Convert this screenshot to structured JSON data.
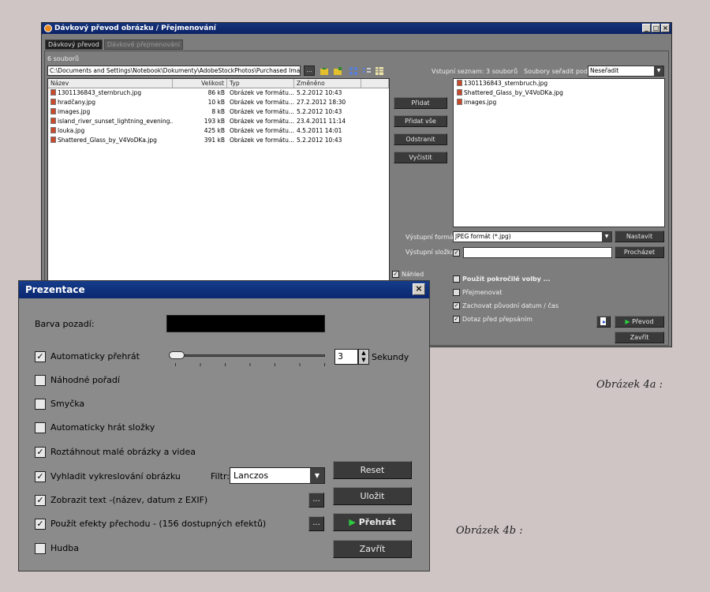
{
  "main_window": {
    "title": "Dávkový převod obrázku / Přejmenování",
    "controls": [
      "_",
      "□",
      "×"
    ],
    "tabs": [
      "Dávkový převod",
      "Dávkové přejmenování"
    ],
    "file_count": "6 souborů",
    "path": "C:\\Documents and Settings\\Notebook\\Dokumenty\\AdobeStockPhotos\\Purchased Images\\Pra",
    "path_button": "...",
    "columns": [
      "Název",
      "Velikost",
      "Typ",
      "Změněno"
    ],
    "files": [
      {
        "name": "1301136843_sternbruch.jpg",
        "size": "86 kB",
        "type": "Obrázek ve formátu...",
        "modified": "5.2.2012 10:43"
      },
      {
        "name": "hradčany.jpg",
        "size": "10 kB",
        "type": "Obrázek ve formátu...",
        "modified": "27.2.2012 18:30"
      },
      {
        "name": "images.jpg",
        "size": "8 kB",
        "type": "Obrázek ve formátu...",
        "modified": "5.2.2012 10:43"
      },
      {
        "name": "island_river_sunset_lightning_evening...",
        "size": "193 kB",
        "type": "Obrázek ve formátu...",
        "modified": "23.4.2011 11:14"
      },
      {
        "name": "louka.jpg",
        "size": "425 kB",
        "type": "Obrázek ve formátu...",
        "modified": "4.5.2011 14:01"
      },
      {
        "name": "Shattered_Glass_by_V4VoDKa.jpg",
        "size": "391 kB",
        "type": "Obrázek ve formátu...",
        "modified": "5.2.2012 10:43"
      }
    ],
    "buttons": {
      "add": "Přidat",
      "add_all": "Přidat vše",
      "remove": "Odstranit",
      "clear": "Vyčistit"
    },
    "input_list_label": "Vstupní seznam: 3 souborů",
    "sort_label": "Soubory seřadit podle:",
    "sort_value": "Neseřadit",
    "input_files": [
      "1301136843_sternbruch.jpg",
      "Shattered_Glass_by_V4VoDKa.jpg",
      "images.jpg"
    ],
    "output_format_label": "Výstupní formát:",
    "output_format_value": "JPEG formát (*.jpg)",
    "configure_button": "Nastavit",
    "output_folder_label": "Výstupní složka:",
    "browse_button": "Procházet",
    "preview_label": "Náhled",
    "advanced_label": "Použít pokročilé volby ...",
    "rename_label": "Přejmenovat",
    "keep_date_label": "Zachovat původní datum / čas",
    "ask_overwrite_label": "Dotaz před přepsáním",
    "convert_button": "Převod",
    "close_button": "Zavřít"
  },
  "dialog": {
    "title": "Prezentace",
    "close": "×",
    "bg_color_label": "Barva pozadí:",
    "bg_color": "#000000",
    "autoplay_label": "Automaticky přehrát",
    "seconds_value": "3",
    "seconds_label": "Sekundy",
    "random_label": "Náhodné pořadí",
    "loop_label": "Smyčka",
    "auto_folders_label": "Automaticky hrát složky",
    "stretch_label": "Roztáhnout malé obrázky a videa",
    "smooth_label": "Vyhladit vykreslování obrázku",
    "filter_label": "Filtr:",
    "filter_value": "Lanczos",
    "show_text_label": "Zobrazit text -(název, datum z EXIF)",
    "effects_label": "Použít efekty přechodu   -   (156 dostupných efektů)",
    "music_label": "Hudba",
    "dots_label": "...",
    "reset_button": "Reset",
    "save_button": "Uložit",
    "play_button": "Přehrát",
    "close_button": "Zavřít"
  },
  "captions": {
    "a": "Obrázek 4a  :",
    "b": "Obrázek 4b :"
  },
  "colors": {
    "titlebar": "#0b2266",
    "window_bg": "#7d7d7d",
    "page_bg": "#cfc5c5",
    "accent_green": "#2ecc40"
  }
}
